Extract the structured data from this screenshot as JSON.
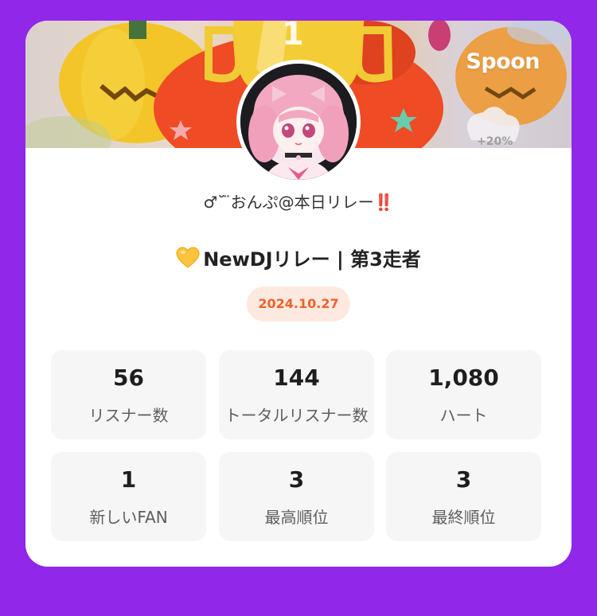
{
  "brand": "Spoon",
  "username": "♂˘ ̈おんぷ@本日リレー‼️",
  "title": "NewDJリレー | 第3走者",
  "date": "2024.10.27",
  "banner": {
    "trophy_number": "1",
    "badge_text": "+20%"
  },
  "stats": [
    {
      "value": "56",
      "label": "リスナー数"
    },
    {
      "value": "144",
      "label": "トータルリスナー数"
    },
    {
      "value": "1,080",
      "label": "ハート"
    },
    {
      "value": "1",
      "label": "新しいFAN"
    },
    {
      "value": "3",
      "label": "最高順位"
    },
    {
      "value": "3",
      "label": "最終順位"
    }
  ],
  "colors": {
    "background": "#9127e8",
    "card": "#ffffff",
    "date_text": "#f0622a",
    "date_bg": "#fde9e0",
    "stat_bg": "#f6f6f6"
  }
}
